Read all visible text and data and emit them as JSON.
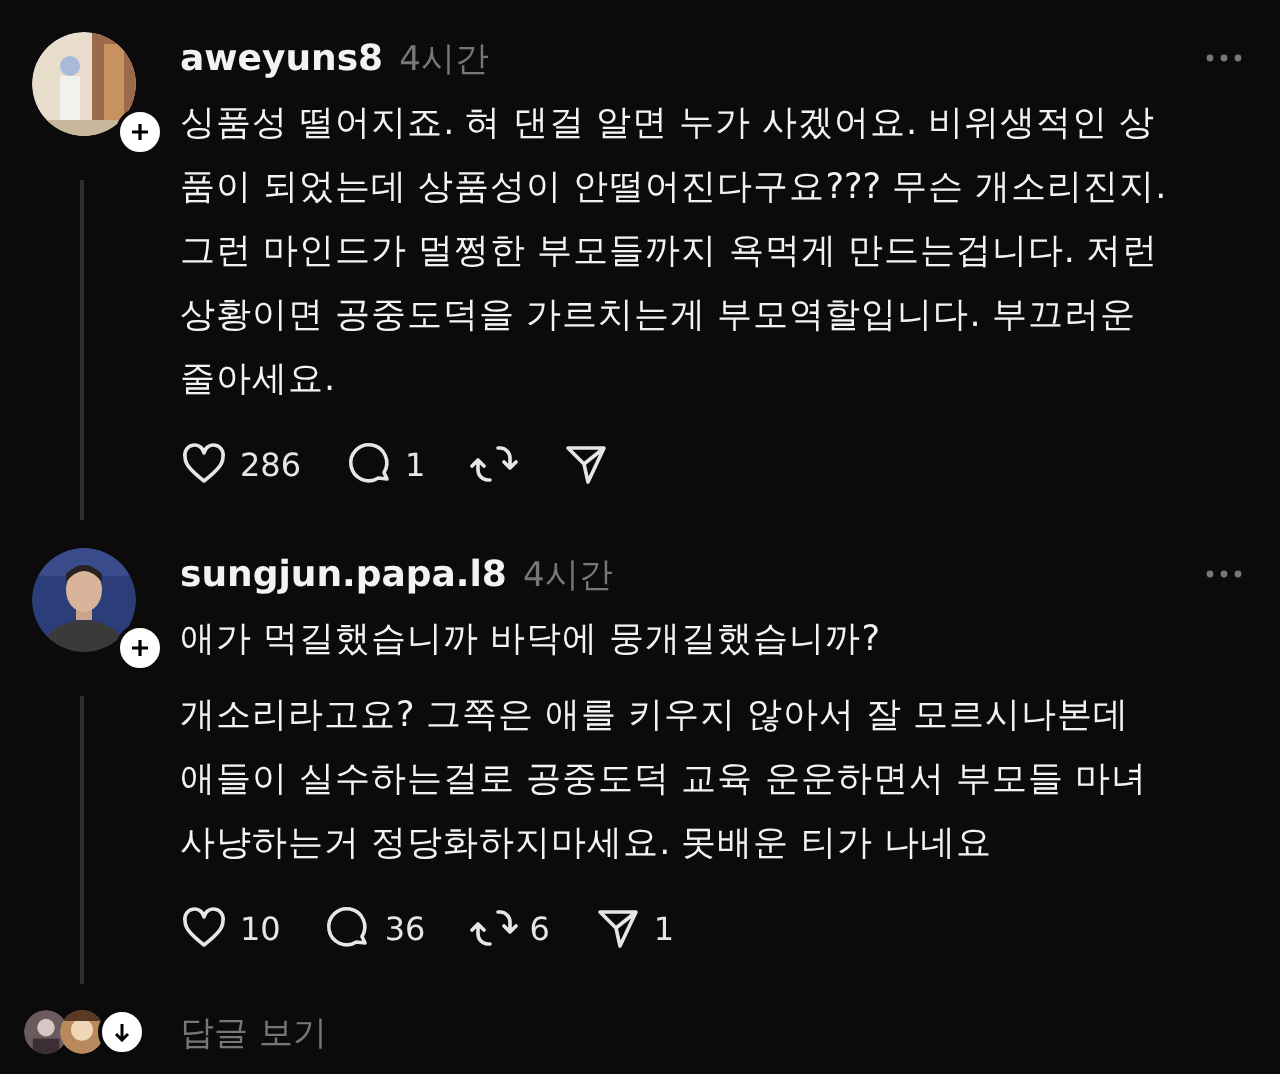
{
  "comments": [
    {
      "username": "aweyuns8",
      "time": "4시간",
      "paragraphs": [
        [
          "싱품성 떨어지죠. 혀 댄걸 알면 누가 사겠어요. 비위생적인 상",
          "품이 되었는데 상품성이 안떨어진다구요??? 무슨 개소리진지.",
          "그런 마인드가 멀쩡한 부모들까지 욕먹게 만드는겁니다. 저런",
          "상황이면 공중도덕을 가르치는게 부모역할입니다. 부끄러운",
          "줄아세요."
        ]
      ],
      "actions": [
        {
          "kind": "like",
          "count": "286"
        },
        {
          "kind": "reply",
          "count": "1"
        },
        {
          "kind": "repost"
        },
        {
          "kind": "share"
        }
      ]
    },
    {
      "username": "sungjun.papa.l8",
      "time": "4시간",
      "paragraphs": [
        [
          "애가 먹길했습니까 바닥에 뭉개길했습니까?"
        ],
        [
          "개소리라고요? 그쪽은 애를 키우지 않아서 잘 모르시나본데",
          "애들이 실수하는걸로 공중도덕 교육 운운하면서 부모들 마녀",
          "사냥하는거 정당화하지마세요. 못배운 티가 나네요"
        ]
      ],
      "actions": [
        {
          "kind": "like",
          "count": "10"
        },
        {
          "kind": "reply",
          "count": "36"
        },
        {
          "kind": "repost",
          "count": "6"
        },
        {
          "kind": "share",
          "count": "1"
        }
      ]
    }
  ],
  "view_replies": {
    "label": "답글 보기"
  }
}
